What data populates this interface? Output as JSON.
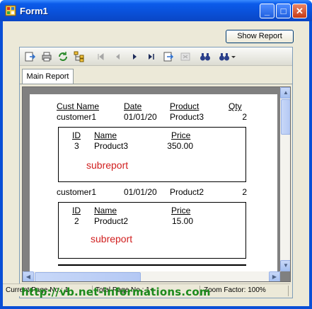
{
  "window": {
    "title": "Form1",
    "minimize": "_",
    "maximize": "□",
    "close": "✕"
  },
  "toolbar_buttons": {
    "show_report": "Show Report"
  },
  "viewer": {
    "tab_label": "Main Report",
    "icons": [
      "export-icon",
      "print-icon",
      "refresh-icon",
      "group-tree-icon",
      "first-page-icon",
      "previous-page-icon",
      "next-page-icon",
      "last-page-icon",
      "goto-page-icon",
      "close-view-icon",
      "search-icon",
      "zoom-icon"
    ]
  },
  "report": {
    "headers": {
      "cust_name": "Cust Name",
      "date": "Date",
      "product": "Product",
      "qty": "Qty"
    },
    "rows": [
      {
        "customer": "customer1",
        "date": "01/01/20",
        "product": "Product3",
        "qty": "2",
        "subreport": {
          "headers": {
            "id": "ID",
            "name": "Name",
            "price": "Price"
          },
          "id": "3",
          "name": "Product3",
          "price": "350.00",
          "label": "subreport"
        }
      },
      {
        "customer": "customer1",
        "date": "01/01/20",
        "product": "Product2",
        "qty": "2",
        "subreport": {
          "headers": {
            "id": "ID",
            "name": "Name",
            "price": "Price"
          },
          "id": "2",
          "name": "Product2",
          "price": "15.00",
          "label": "subreport"
        }
      }
    ]
  },
  "status": {
    "current_page": "Current Page No.: 1",
    "total_page": "Total Page No.: 1+",
    "zoom": "Zoom Factor: 100%"
  },
  "watermark": "http://vb.net-informations.com"
}
